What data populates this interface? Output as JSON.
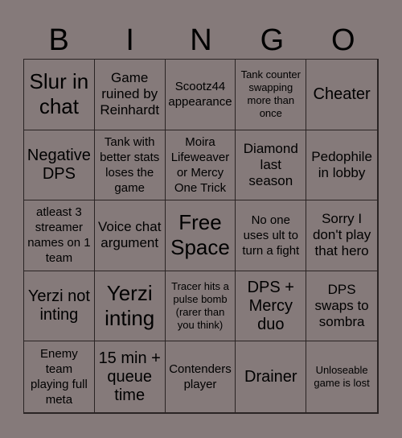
{
  "header": {
    "letters": [
      "B",
      "I",
      "N",
      "G",
      "O"
    ]
  },
  "board": {
    "cells": [
      "Slur in chat",
      "Game ruined by Reinhardt",
      "Scootz44 appearance",
      "Tank counter swapping more than once",
      "Cheater",
      "Negative DPS",
      "Tank with better stats loses the game",
      "Moira Lifeweaver or Mercy One Trick",
      "Diamond last season",
      "Pedophile in lobby",
      "atleast 3 streamer names on 1 team",
      "Voice chat argument",
      "Free Space",
      "No one uses ult to turn a fight",
      "Sorry I don't play that hero",
      "Yerzi not inting",
      "Yerzi inting",
      "Tracer hits a pulse bomb (rarer than you think)",
      "DPS + Mercy duo",
      "DPS swaps to sombra",
      "Enemy team playing full meta",
      "15 min + queue time",
      "Contenders player",
      "Drainer",
      "Unloseable game is lost"
    ]
  },
  "colors": {
    "background": "#857a7a",
    "grid_lines": "#2a2424",
    "text": "#000000"
  }
}
